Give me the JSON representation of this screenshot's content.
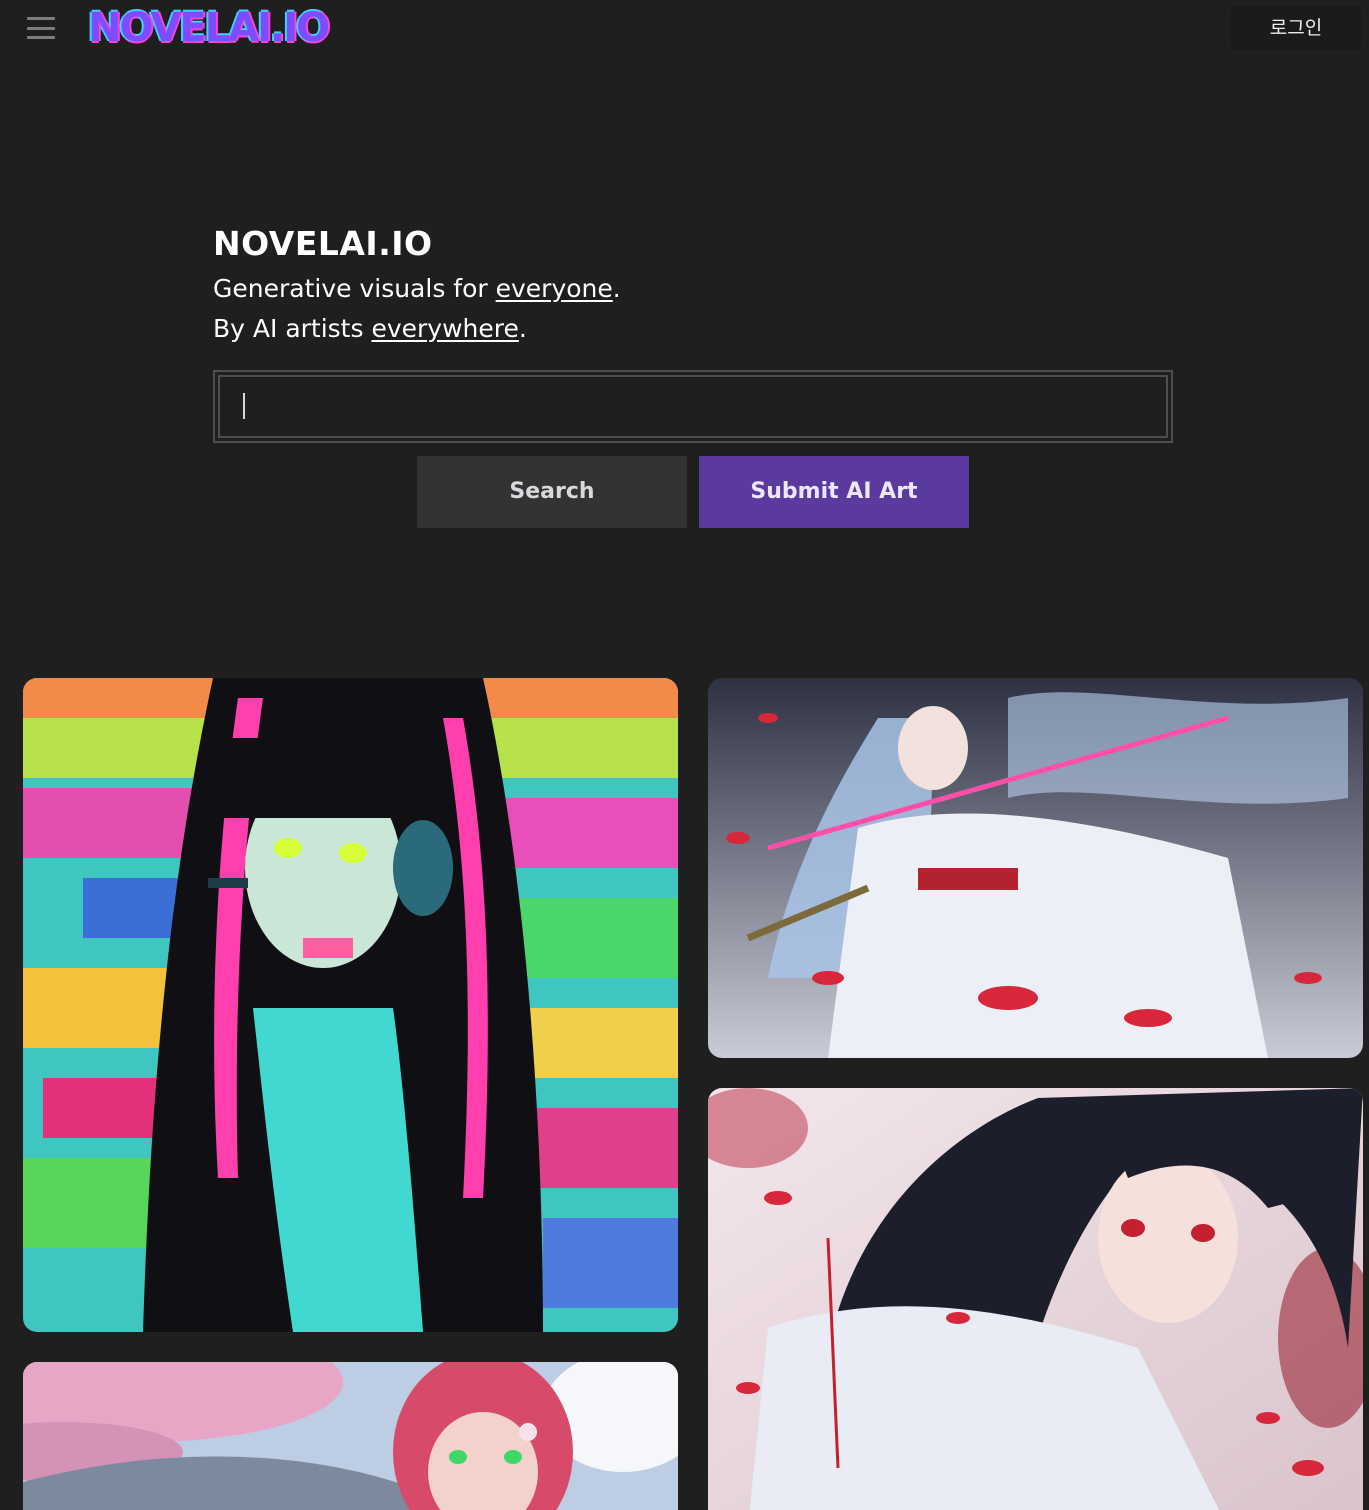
{
  "header": {
    "logo_text": "NOVELAI.IO",
    "login_label": "로그인",
    "menu_icon": "hamburger-menu-icon"
  },
  "hero": {
    "title": "NOVELAI.IO",
    "line1_prefix": "Generative visuals for ",
    "line1_link": "everyone",
    "line1_suffix": ".",
    "line2_prefix": "By AI artists ",
    "line2_link": "everywhere",
    "line2_suffix": "."
  },
  "search": {
    "value": "",
    "placeholder": ""
  },
  "buttons": {
    "search_label": "Search",
    "submit_label": "Submit AI Art"
  },
  "colors": {
    "background": "#1f1f20",
    "search_button": "#333335",
    "submit_button": "#5b3a9e",
    "logo_primary": "#7b4dff",
    "logo_accent": "#ff3fd8"
  },
  "gallery": {
    "items": [
      {
        "subject": "anime girl with headset on colorful glitch background"
      },
      {
        "subject": "silver-haired swordswoman in white kimono with red petals"
      },
      {
        "subject": "dark-haired girl in white kimono among red petals"
      },
      {
        "subject": "red-haired girl under cherry blossoms"
      }
    ]
  }
}
